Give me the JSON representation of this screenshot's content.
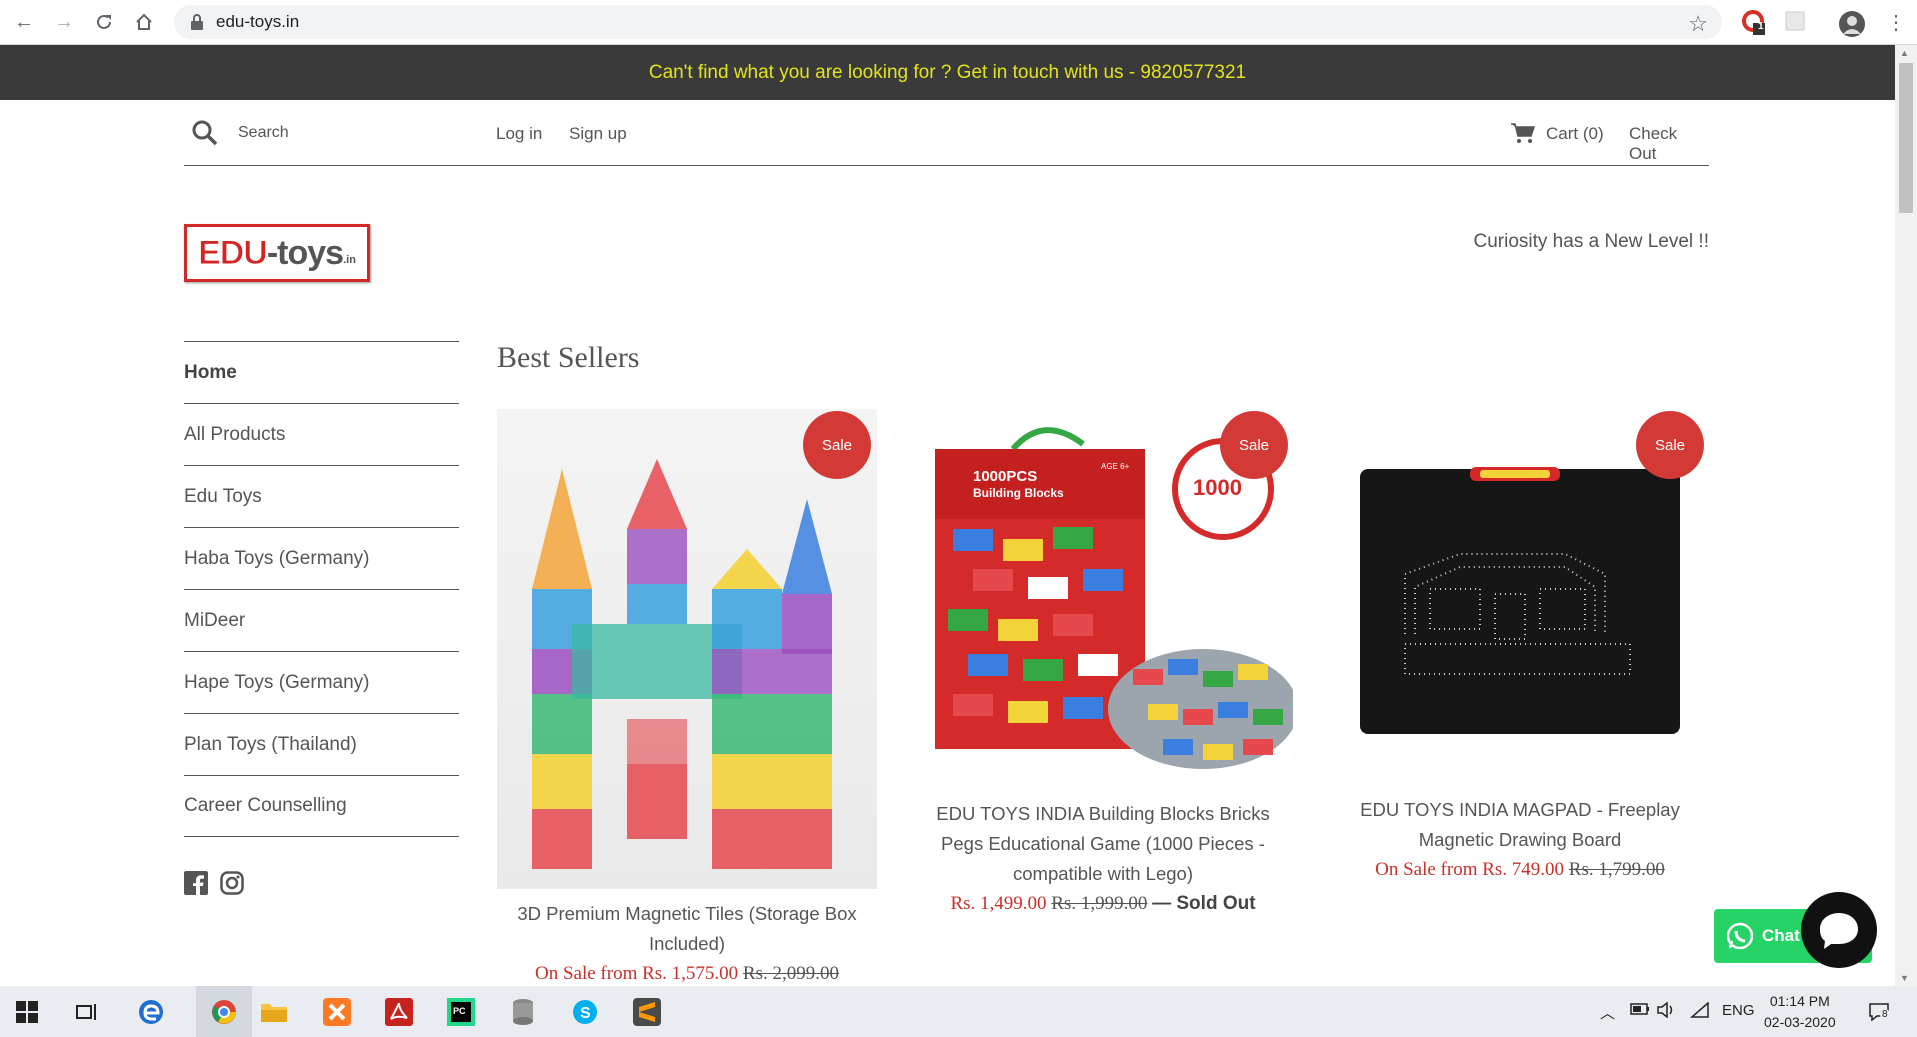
{
  "browser": {
    "url": "edu-toys.in",
    "ext_badge": "1"
  },
  "announcement": "Can't find what you are looking for ? Get in touch with us - 9820577321",
  "topnav": {
    "search_placeholder": "Search",
    "login": "Log in",
    "signup": "Sign up",
    "cart": "Cart (0)",
    "checkout": "Check Out"
  },
  "logo": {
    "edu": "EDU",
    "toys": "-toys",
    "tld": ".in"
  },
  "tagline": "Curiosity has a New Level !!",
  "sidebar": {
    "items": [
      {
        "label": "Home"
      },
      {
        "label": "All Products"
      },
      {
        "label": "Edu Toys"
      },
      {
        "label": "Haba Toys (Germany)"
      },
      {
        "label": "MiDeer"
      },
      {
        "label": "Hape Toys (Germany)"
      },
      {
        "label": "Plan Toys (Thailand)"
      },
      {
        "label": "Career Counselling"
      }
    ]
  },
  "section_title": "Best Sellers",
  "products": [
    {
      "badge": "Sale",
      "title_line1": "3D Premium Magnetic Tiles (Storage Box",
      "title_line2": "Included)",
      "price_sale": "On Sale from Rs. 1,575.00",
      "price_orig": "Rs. 2,099.00"
    },
    {
      "badge": "Sale",
      "box_text1": "1000PCS",
      "box_text2": "Building Blocks",
      "box_age": "AGE 6+",
      "seal_text": "1000",
      "title_line1": "EDU TOYS INDIA Building Blocks Bricks",
      "title_line2": "Pegs Educational Game (1000 Pieces -",
      "title_line3": "compatible with Lego)",
      "price_sale": "Rs. 1,499.00",
      "price_orig": "Rs. 1,999.00",
      "sold_out": "— Sold Out"
    },
    {
      "badge": "Sale",
      "title_line1": "EDU TOYS INDIA MAGPAD - Freeplay",
      "title_line2": "Magnetic Drawing Board",
      "price_sale": "On Sale from Rs. 749.00",
      "price_orig": "Rs. 1,799.00"
    }
  ],
  "chat": {
    "label": "Chat"
  },
  "taskbar": {
    "lang": "ENG",
    "time": "01:14 PM",
    "date": "02-03-2020",
    "notifications": "8"
  }
}
